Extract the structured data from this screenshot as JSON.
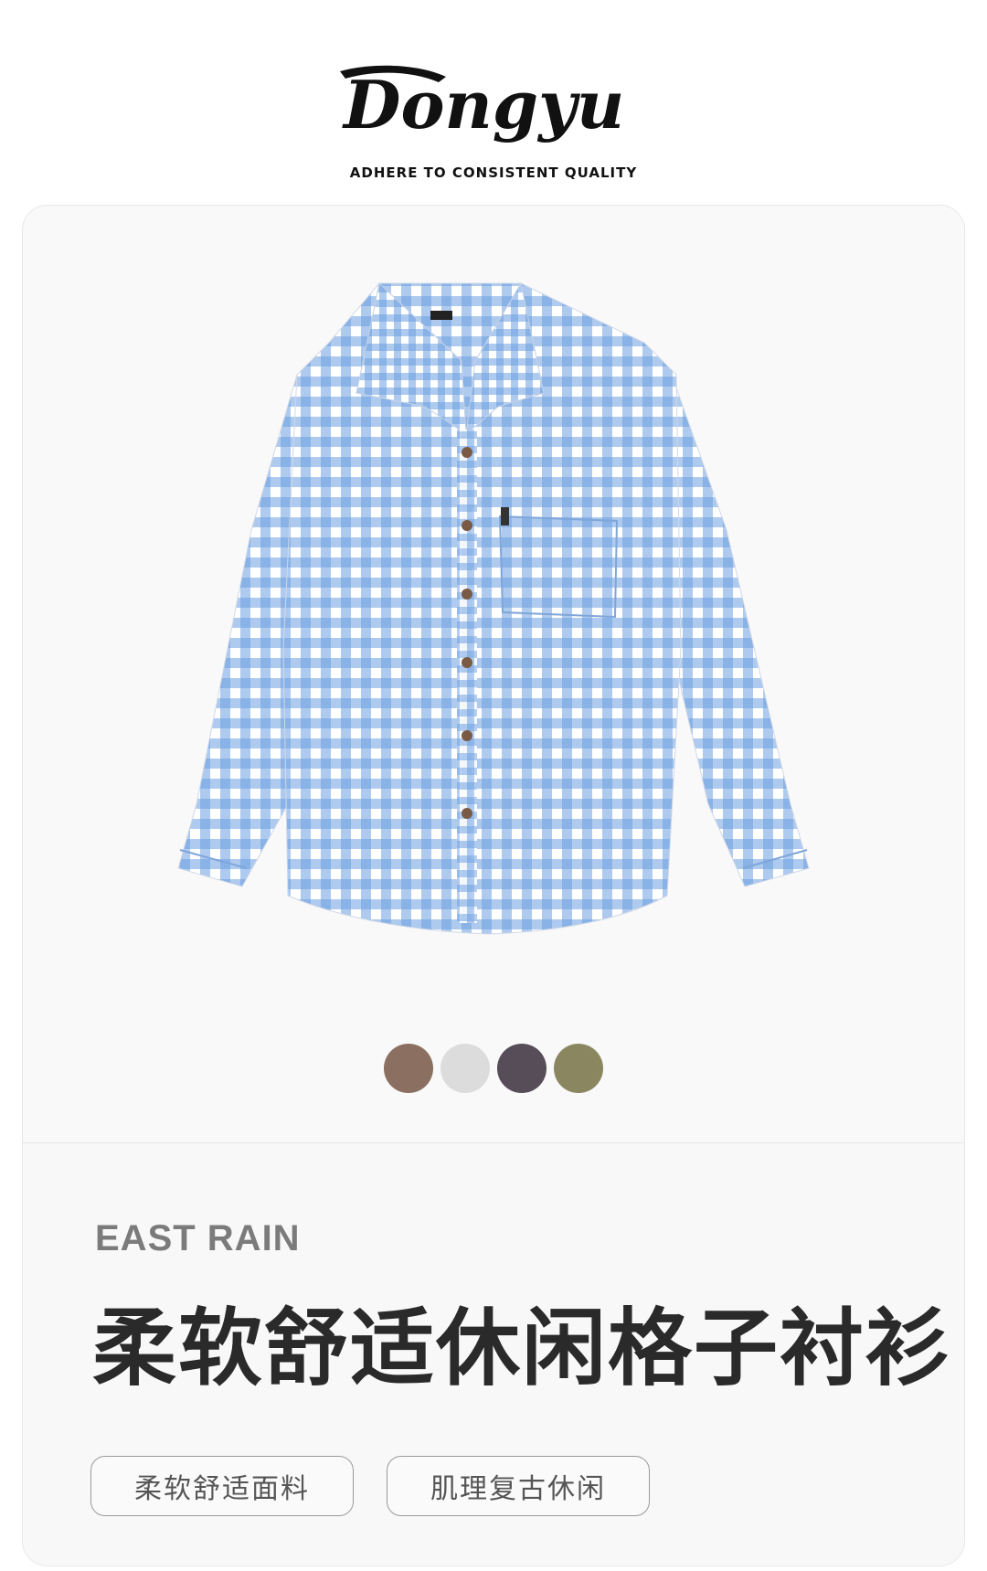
{
  "brand": {
    "logo_text": "Dongyu",
    "tagline": "ADHERE TO CONSISTENT QUALITY"
  },
  "product": {
    "image_icon": "plaid-shirt-image",
    "shirt_colors": {
      "blue": "#6b9fe0",
      "white": "#ffffff",
      "button": "#7a5a44"
    },
    "colors": [
      {
        "name": "brown",
        "hex": "#8b6f60"
      },
      {
        "name": "light-gray",
        "hex": "#dcdcdc"
      },
      {
        "name": "dark-plum",
        "hex": "#564d58"
      },
      {
        "name": "olive",
        "hex": "#8a8760"
      }
    ],
    "brand_name": "EAST RAIN",
    "title": "柔软舒适休闲格子衬衫",
    "tags": [
      "柔软舒适面料",
      "肌理复古休闲"
    ]
  }
}
